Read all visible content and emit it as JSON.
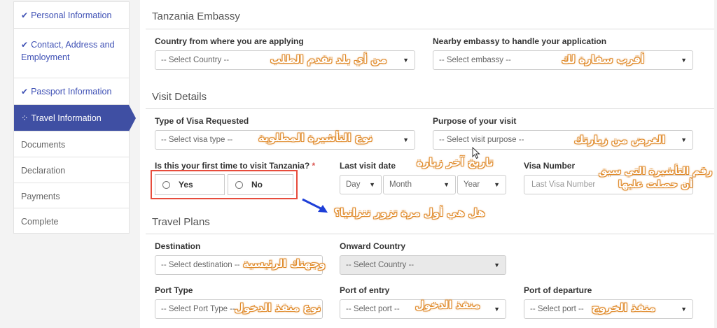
{
  "sidebar": {
    "items": [
      {
        "label": "Personal Information",
        "state": "done"
      },
      {
        "label": "Contact, Address and Employment",
        "state": "done"
      },
      {
        "label": "Passport Information",
        "state": "done"
      },
      {
        "label": "Travel Information",
        "state": "active"
      },
      {
        "label": "Documents",
        "state": "pending"
      },
      {
        "label": "Declaration",
        "state": "pending"
      },
      {
        "label": "Payments",
        "state": "pending"
      },
      {
        "label": "Complete",
        "state": "pending"
      }
    ]
  },
  "sections": {
    "embassy": "Tanzania Embassy",
    "visit": "Visit Details",
    "travel": "Travel Plans"
  },
  "embassy": {
    "country_label": "Country from where you are applying",
    "country_value": "-- Select Country --",
    "nearby_label": "Nearby embassy to handle your application",
    "nearby_value": "-- Select embassy --"
  },
  "visit": {
    "visa_type_label": "Type of Visa Requested",
    "visa_type_value": "-- Select visa type --",
    "purpose_label": "Purpose of your visit",
    "purpose_value": "-- Select visit purpose --",
    "first_time_label": "Is this your first time to visit Tanzania?",
    "required_mark": "*",
    "yes_label": "Yes",
    "no_label": "No",
    "last_visit_label": "Last visit date",
    "day_value": "Day",
    "month_value": "Month",
    "year_value": "Year",
    "visa_number_label": "Visa Number",
    "visa_number_placeholder": "Last Visa Number"
  },
  "travel": {
    "destination_label": "Destination",
    "destination_value": "-- Select destination --",
    "onward_label": "Onward Country",
    "onward_value": "-- Select Country --",
    "port_type_label": "Port Type",
    "port_type_value": "-- Select Port Type --",
    "port_entry_label": "Port of entry",
    "port_entry_value": "-- Select port --",
    "port_departure_label": "Port of departure",
    "port_departure_value": "-- Select port --"
  },
  "annotations": {
    "country": "من أي بلد تقدم الطلب",
    "nearby": "أقرب سفارة لك",
    "visa_type": "نوع التأشيرة المطلوبة",
    "purpose": "الغرض من زيارتك",
    "last_visit": "تاريخ آخر زيارة",
    "visa_number_1": "رقم التأشيرة التي سبق",
    "visa_number_2": "أن حصلت عليها",
    "first_time": "هل هي أول مرة تزور تنزانيا؟",
    "destination": "وجهتك الرئيسية",
    "port_type": "نوع منفذ الدخول",
    "port_entry": "منفذ الدخول",
    "port_departure": "منفذ الخروج"
  },
  "colors": {
    "accent": "#3f4fa3",
    "done": "#3f51b5",
    "highlight": "#e74c3c",
    "annotation_outline": "#e08a2a",
    "arrow": "#1e3fd8"
  }
}
